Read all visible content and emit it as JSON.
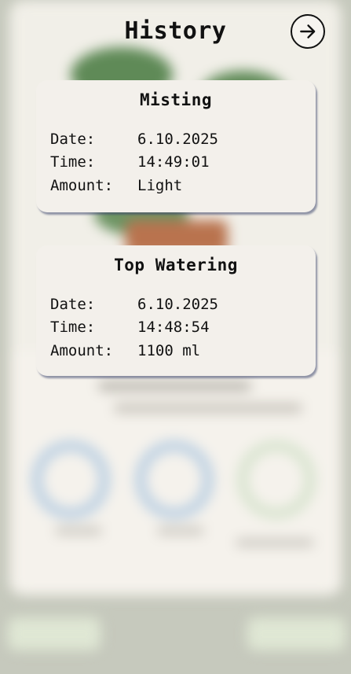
{
  "header": {
    "title": "History"
  },
  "close_button": {
    "icon": "arrow-right-circle-icon"
  },
  "entries": [
    {
      "title": "Misting",
      "rows": [
        {
          "label": "Date:",
          "value": "6.10.2025"
        },
        {
          "label": "Time:",
          "value": "14:49:01"
        },
        {
          "label": "Amount:",
          "value": "Light"
        }
      ]
    },
    {
      "title": "Top Watering",
      "rows": [
        {
          "label": "Date:",
          "value": "6.10.2025"
        },
        {
          "label": "Time:",
          "value": "14:48:54"
        },
        {
          "label": "Amount:",
          "value": "1100 ml"
        }
      ]
    }
  ],
  "colors": {
    "card_background": "#f3f0eb",
    "card_shadow": "#3c466e",
    "overlay_background": "#c6c9bd"
  }
}
